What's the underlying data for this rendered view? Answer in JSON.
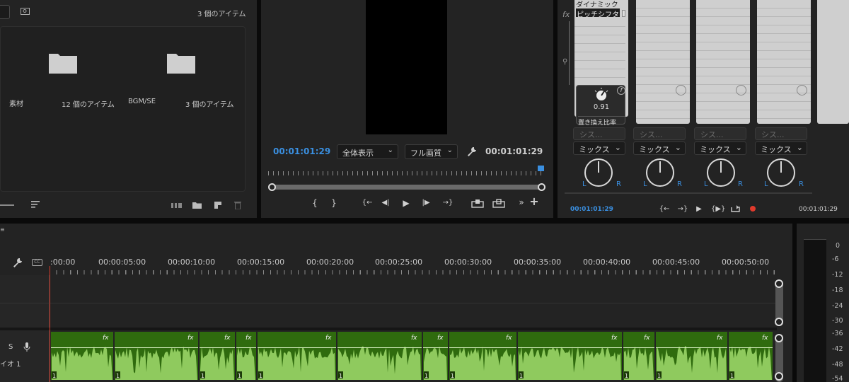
{
  "project_panel": {
    "item_count": "3 個のアイテム",
    "bins": [
      {
        "name": "素材",
        "count": "12 個のアイテム"
      },
      {
        "name": "BGM/SE",
        "count": "3 個のアイテム"
      }
    ]
  },
  "program_monitor": {
    "timecode_current": "00:01:01:29",
    "timecode_duration": "00:01:01:29",
    "zoom_select": "全体表示",
    "quality_select": "フル画質",
    "transport": {
      "mark_in": "{",
      "mark_out": "}",
      "go_in": "{←",
      "step_back": "◀|",
      "play": "▶",
      "step_fwd": "|▶",
      "go_out": "→}",
      "more": "»",
      "add": "+"
    }
  },
  "audio_mixer": {
    "effect_slots": [
      "ダイナミック",
      "ピッチシフタ"
    ],
    "knob_value": "0.91",
    "knob_param": "置き換え比率",
    "send_select": "シス...",
    "mode_select": "ミックス",
    "pan_left": "L",
    "pan_right": "R",
    "timecode_left": "00:01:01:29",
    "timecode_right": "00:01:01:29",
    "fx_label": "fx"
  },
  "timeline": {
    "ruler": [
      "00:00",
      "00:00:05:00",
      "00:00:10:00",
      "00:00:15:00",
      "00:00:20:00",
      "00:00:25:00",
      "00:00:30:00",
      "00:00:35:00",
      "00:00:40:00",
      "00:00:45:00",
      "00:00:50:00"
    ],
    "ruler_first_prefix": ":",
    "audio_track": {
      "solo": "S",
      "name": "イオ 1"
    },
    "clip_fx": "fx",
    "clip_channel": "1"
  },
  "meter": {
    "ticks": [
      "0",
      "-6",
      "-12",
      "-18",
      "-24",
      "-30",
      "-36",
      "-42",
      "-48",
      "-54"
    ]
  },
  "colors": {
    "clip_dark": "#2f6b0e",
    "clip_wave": "#8fca5e",
    "accent_blue": "#3a8fe0",
    "record_red": "#e03a2c"
  }
}
